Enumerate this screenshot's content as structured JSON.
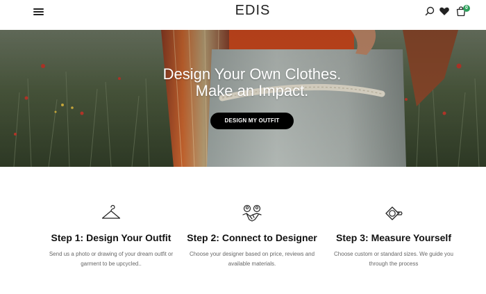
{
  "header": {
    "logo": "EDIS",
    "cart_count": "0"
  },
  "icons": {
    "menu": "hamburger-menu-icon",
    "search": "search-icon",
    "wishlist": "heart-icon",
    "cart": "shopping-bag-icon",
    "step1": "hanger-icon",
    "step2": "handshake-icon",
    "step3": "measuring-tape-icon"
  },
  "colors": {
    "badge": "#2c9e5a",
    "cta_bg": "#000000",
    "cta_text": "#ffffff"
  },
  "hero": {
    "title_line1": "Design Your Own Clothes.",
    "title_line2": "Make an Impact.",
    "cta_label": "DESIGN MY OUTFIT"
  },
  "steps": [
    {
      "title": "Step 1: Design Your Outfit",
      "description": "Send us a photo or drawing of your dream outfit or garment to be upcycled.."
    },
    {
      "title": "Step 2: Connect to Designer",
      "description": "Choose your designer based on price, reviews and available materials."
    },
    {
      "title": "Step 3: Measure Yourself",
      "description": "Choose custom or standard sizes. We guide you through the process"
    }
  ]
}
